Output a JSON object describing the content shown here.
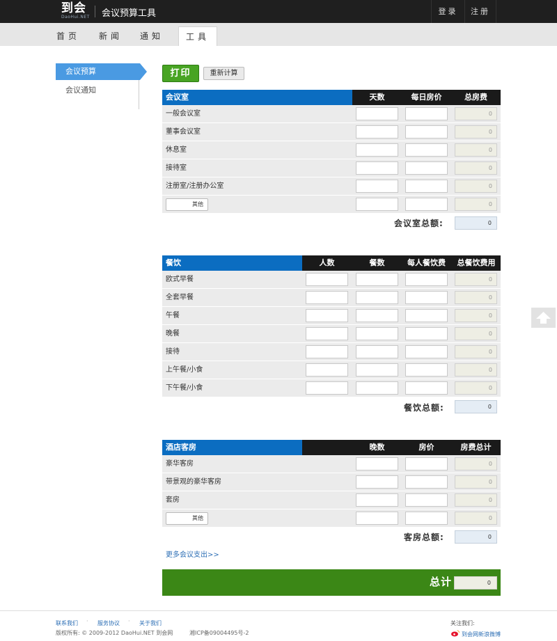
{
  "header": {
    "logo_text": "到会",
    "logo_sub": "DaoHui.NET",
    "app_title": "会议预算工具",
    "login": "登录",
    "register": "注册"
  },
  "nav": {
    "tabs": [
      "首页",
      "新闻",
      "通知",
      "工具"
    ],
    "active": "工具"
  },
  "sidebar": {
    "items": [
      "会议预算",
      "会议通知"
    ]
  },
  "toolbar": {
    "print": "打印",
    "recalc": "重新计算"
  },
  "rooms": {
    "title": "会议室",
    "cols": [
      "天数",
      "每日房价",
      "总房费"
    ],
    "rows": [
      "一般会议室",
      "董事会议室",
      "休息室",
      "接待室",
      "注册室/注册办公室"
    ],
    "other_button": "其他",
    "row_total": "0",
    "sum_label": "会议室总额:",
    "sum_value": "0"
  },
  "catering": {
    "title": "餐饮",
    "cols": [
      "人数",
      "餐数",
      "每人餐饮费",
      "总餐饮费用"
    ],
    "rows": [
      "欧式早餐",
      "全套早餐",
      "午餐",
      "晚餐",
      "接待",
      "上午餐/小食",
      "下午餐/小食"
    ],
    "row_total": "0",
    "sum_label": "餐饮总额:",
    "sum_value": "0"
  },
  "hotel": {
    "title": "酒店客房",
    "cols": [
      "晚数",
      "房价",
      "房费总计"
    ],
    "rows": [
      "豪华客房",
      "带景观的豪华客房",
      "套房"
    ],
    "other_button": "其他",
    "row_total": "0",
    "sum_label": "客房总额:",
    "sum_value": "0"
  },
  "more_link": "更多会议支出>>",
  "total": {
    "label": "总计",
    "value": "0"
  },
  "footer": {
    "links": [
      "联系我们",
      "服务协议",
      "关于我们"
    ],
    "copyright": "版权所有: © 2009-2012 DaoHui.NET 到会网",
    "icp": "湘ICP备09004495号-2",
    "follow": "关注我们:",
    "weibo": "到会网新浪微博"
  }
}
